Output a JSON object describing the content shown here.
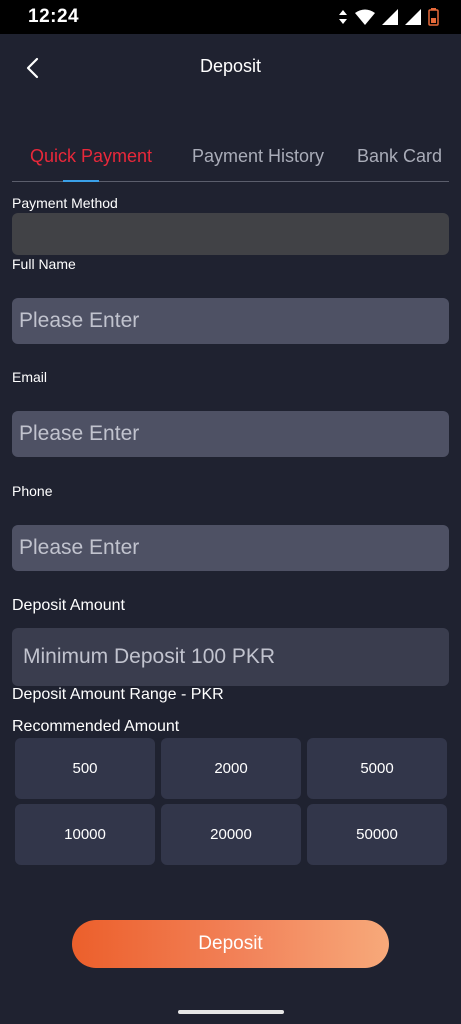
{
  "status_bar": {
    "time": "12:24"
  },
  "header": {
    "title": "Deposit"
  },
  "tabs": [
    {
      "label": "Quick Payment",
      "active": true
    },
    {
      "label": "Payment History",
      "active": false
    },
    {
      "label": "Bank Card",
      "active": false
    }
  ],
  "form": {
    "payment_method_label": "Payment Method",
    "full_name_label": "Full Name",
    "full_name_placeholder": "Please Enter",
    "email_label": "Email",
    "email_placeholder": "Please Enter",
    "phone_label": "Phone",
    "phone_placeholder": "Please Enter",
    "deposit_amount_label": "Deposit Amount",
    "deposit_amount_placeholder": "Minimum Deposit 100 PKR",
    "range_label": "Deposit Amount Range - PKR",
    "recommended_label": "Recommended Amount",
    "recommended_amounts": [
      "500",
      "2000",
      "5000",
      "10000",
      "20000",
      "50000"
    ]
  },
  "deposit_button": "Deposit",
  "colors": {
    "background": "#1f2230",
    "active_tab": "#e8283a",
    "tab_indicator": "#3aa0e8",
    "button_start": "#ec5f2b",
    "button_end": "#f7a97a"
  }
}
